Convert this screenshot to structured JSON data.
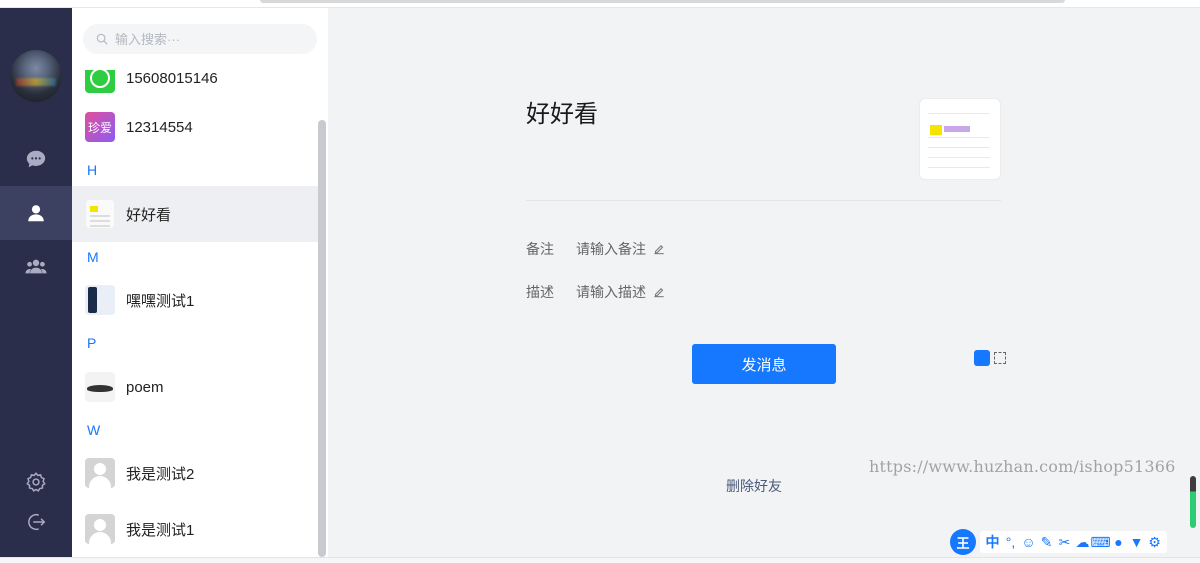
{
  "search": {
    "placeholder": "输入搜索···"
  },
  "contacts": [
    {
      "name": "15608015146",
      "avatar": "whatsapp-avatar"
    },
    {
      "name": "12314554",
      "avatar": "zhenai-avatar",
      "avatar_text": "珍爱"
    },
    {
      "letter": "H"
    },
    {
      "name": "好好看",
      "avatar": "document-avatar",
      "selected": true
    },
    {
      "letter": "M"
    },
    {
      "name": "嘿嘿测试1",
      "avatar": "phone-avatar"
    },
    {
      "letter": "P"
    },
    {
      "name": "poem",
      "avatar": "shark-avatar"
    },
    {
      "letter": "W"
    },
    {
      "name": "我是测试2",
      "avatar": "default-person-avatar"
    },
    {
      "name": "我是测试1",
      "avatar": "default-person-avatar"
    }
  ],
  "detail": {
    "name": "好好看",
    "remark_label": "备注",
    "remark_placeholder": "请输入备注",
    "description_label": "描述",
    "description_placeholder": "请输入描述",
    "send_button": "发消息",
    "delete_link": "删除好友"
  },
  "watermark": "https://www.huzhan.com/ishop51366",
  "ime_toolbar": {
    "logo": "王",
    "mode": "中"
  },
  "colors": {
    "accent": "#1677ff",
    "nav_bg": "#2b2e4a",
    "nav_active": "#3d4161",
    "main_bg": "#f2f3f5"
  },
  "icons": [
    "search-icon",
    "chat-icon",
    "contact-icon",
    "group-icon",
    "settings-icon",
    "logout-icon",
    "edit-icon"
  ]
}
